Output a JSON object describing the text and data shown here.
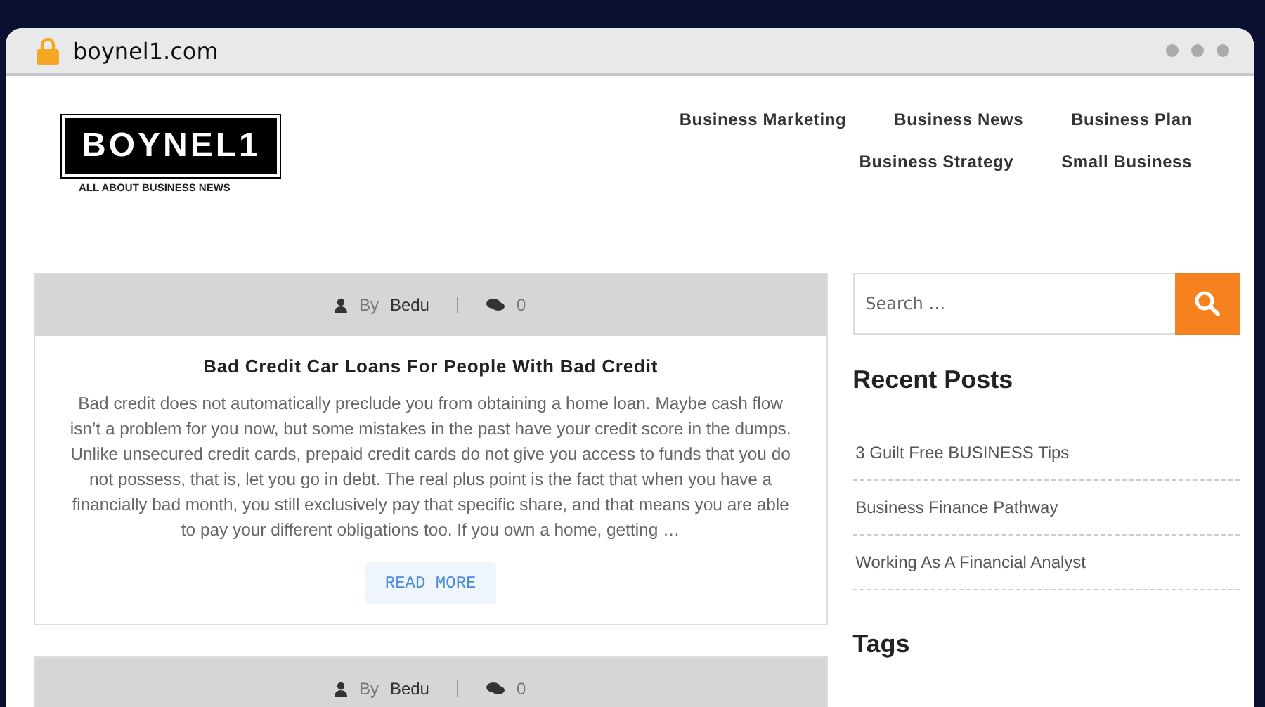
{
  "browser": {
    "address": "boynel1.com"
  },
  "logo": {
    "name": "BOYNEL1",
    "tagline": "ALL ABOUT BUSINESS NEWS"
  },
  "nav": [
    [
      "Business Marketing",
      "Business News",
      "Business Plan"
    ],
    [
      "Business Strategy",
      "Small Business"
    ]
  ],
  "posts": [
    {
      "author_prefix": "By",
      "author": "Bedu",
      "comments": "0",
      "title": "Bad Credit Car Loans For People With Bad Credit",
      "excerpt": "Bad credit does not automatically preclude you from obtaining a home loan. Maybe cash flow isn’t a problem for you now, but some mistakes in the past have your credit score in the dumps. Unlike unsecured credit cards, prepaid credit cards do not give you access to funds that you do not possess, that is, let you go in debt. The real plus point is the fact that when you have a financially bad month, you still exclusively pay that specific share, and that means you are able to pay your different obligations too. If you own a home, getting …",
      "button": "READ MORE"
    },
    {
      "author_prefix": "By",
      "author": "Bedu",
      "comments": "0"
    }
  ],
  "sidebar": {
    "search": {
      "placeholder": "Search …"
    },
    "recent_title": "Recent Posts",
    "recent": [
      "3 Guilt Free BUSINESS Tips",
      "Business Finance Pathway",
      "Working As A Financial Analyst"
    ],
    "tags_title": "Tags"
  }
}
